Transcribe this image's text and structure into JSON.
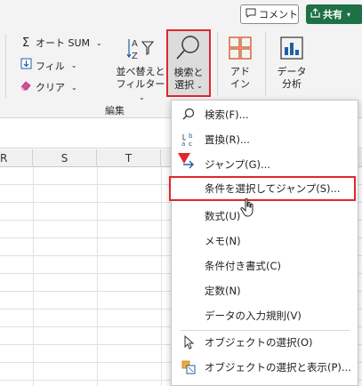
{
  "topbar": {
    "comment_label": "コメント",
    "share_label": "共有",
    "comment_icon": "comment-icon",
    "share_icon": "share-icon",
    "share_color": "#1e7145"
  },
  "ribbon": {
    "autosum_label": "オート SUM",
    "fill_label": "フィル",
    "clear_label": "クリア",
    "sort_filter_line1": "並べ替えと",
    "sort_filter_line2": "フィルター",
    "find_select_line1": "検索と",
    "find_select_line2": "選択",
    "addin_line1": "アド",
    "addin_line2": "イン",
    "analyze_line1": "データ",
    "analyze_line2": "分析",
    "group_label": "編集"
  },
  "columns": [
    "R",
    "S",
    "T"
  ],
  "menu": {
    "items": [
      {
        "label": "検索(F)...",
        "icon": "search-icon"
      },
      {
        "label": "置換(R)...",
        "icon": "replace-icon"
      },
      {
        "label": "ジャンプ(G)...",
        "icon": "goto-arrow-icon"
      },
      {
        "label": "条件を選択してジャンプ(S)...",
        "icon": ""
      },
      {
        "label": "数式(U)",
        "icon": ""
      },
      {
        "label": "メモ(N)",
        "icon": ""
      },
      {
        "label": "条件付き書式(C)",
        "icon": ""
      },
      {
        "label": "定数(N)",
        "icon": ""
      },
      {
        "label": "データの入力規則(V)",
        "icon": ""
      },
      {
        "label": "オブジェクトの選択(O)",
        "icon": "select-objects-icon"
      },
      {
        "label": "オブジェクトの選択と表示(P)...",
        "icon": "selection-pane-icon"
      }
    ]
  },
  "colors": {
    "highlight": "#e0262d",
    "accent": "#1e7145"
  }
}
